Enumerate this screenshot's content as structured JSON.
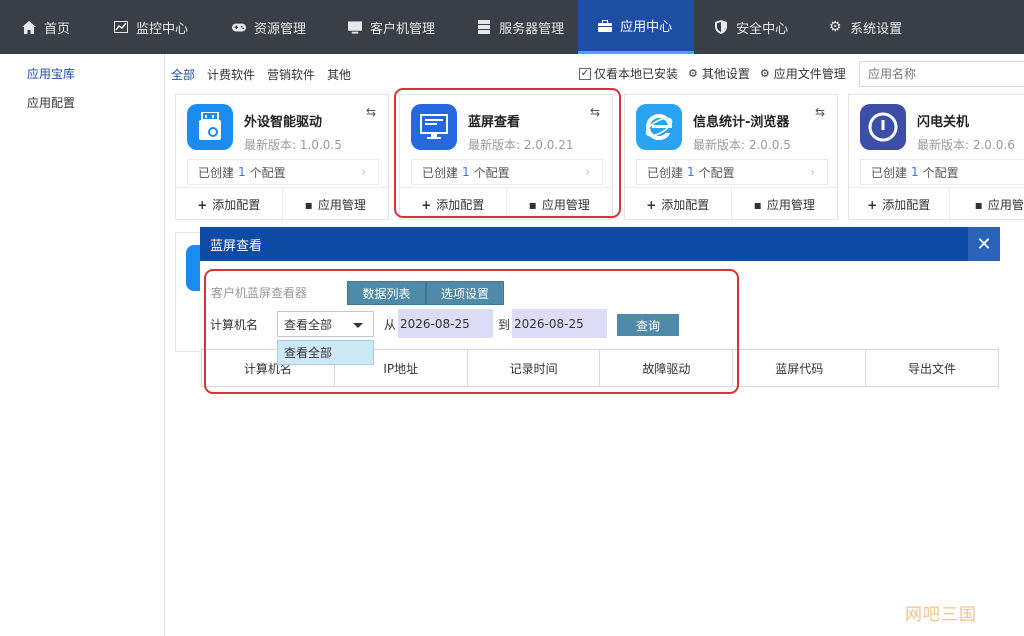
{
  "topnav": {
    "items": [
      {
        "label": "首页",
        "icon": "home-icon"
      },
      {
        "label": "监控中心",
        "icon": "monitor-chart-icon"
      },
      {
        "label": "资源管理",
        "icon": "gamepad-icon"
      },
      {
        "label": "客户机管理",
        "icon": "desktop-icon"
      },
      {
        "label": "服务器管理",
        "icon": "server-icon"
      },
      {
        "label": "应用中心",
        "icon": "briefcase-icon",
        "active": true
      },
      {
        "label": "安全中心",
        "icon": "shield-icon"
      },
      {
        "label": "系统设置",
        "icon": "gear-icon"
      }
    ]
  },
  "sidebar": {
    "items": [
      {
        "label": "应用宝库",
        "active": true
      },
      {
        "label": "应用配置"
      }
    ]
  },
  "filters": {
    "items": [
      "全部",
      "计费软件",
      "营销软件",
      "其他"
    ]
  },
  "tools": {
    "local_only": "仅看本地已安装",
    "other_settings": "其他设置",
    "file_mgmt": "应用文件管理",
    "search_placeholder": "应用名称"
  },
  "cards": [
    {
      "name": "外设智能驱动",
      "version": "最新版本: 1.0.0.5",
      "config_prefix": "已创建",
      "config_count": "1",
      "config_suffix": "个配置",
      "add": "添加配置",
      "manage": "应用管理",
      "icon": "usb-drive-icon"
    },
    {
      "name": "蓝屏查看",
      "version": "最新版本: 2.0.0.21",
      "config_prefix": "已创建",
      "config_count": "1",
      "config_suffix": "个配置",
      "add": "添加配置",
      "manage": "应用管理",
      "icon": "monitor-screen-icon"
    },
    {
      "name": "信息统计-浏览器",
      "version": "最新版本: 2.0.0.5",
      "config_prefix": "已创建",
      "config_count": "1",
      "config_suffix": "个配置",
      "add": "添加配置",
      "manage": "应用管理",
      "icon": "ie-browser-icon"
    },
    {
      "name": "闪电关机",
      "version": "最新版本: 2.0.0.6",
      "config_prefix": "已创建",
      "config_count": "1",
      "config_suffix": "个配置",
      "add": "添加配置",
      "manage": "应用管",
      "icon": "power-icon"
    }
  ],
  "modal": {
    "title": "蓝屏查看",
    "viewer_label": "客户机蓝屏查看器",
    "tabs": [
      "数据列表",
      "选项设置"
    ],
    "computer_label": "计算机名",
    "select_value": "查看全部",
    "from_label": "从",
    "from_date": "2026-08-25",
    "to_label": "到",
    "to_date": "2026-08-25",
    "query": "查询",
    "columns": [
      "计算机名",
      "IP地址",
      "记录时间",
      "故障驱动",
      "蓝屏代码",
      "导出文件"
    ],
    "dropdown_option": "查看全部"
  },
  "watermark": "网吧三国",
  "colors": {
    "nav_bg": "#3a3f47",
    "active_nav": "#1c4fa3",
    "modal_bar": "#0d4aa6",
    "highlight": "#d9333a",
    "tab_bg": "#4f8aa8"
  }
}
